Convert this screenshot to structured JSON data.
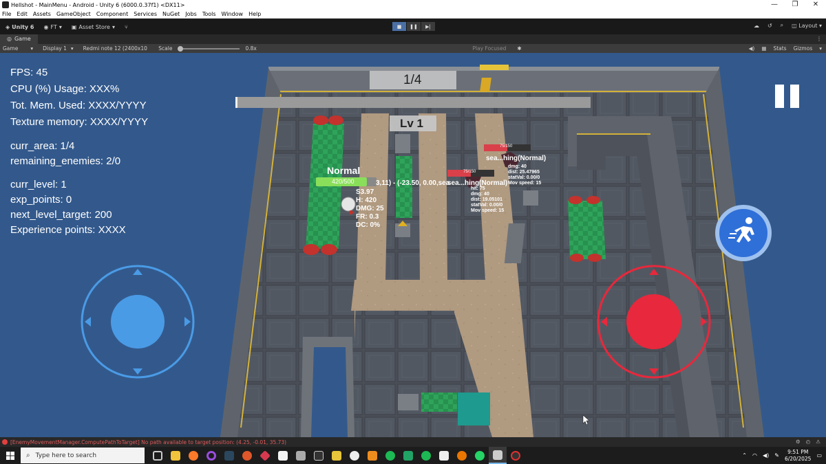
{
  "window": {
    "title": "Hellshot - MainMenu - Android - Unity 6 (6000.0.37f1) <DX11>",
    "minimize": "—",
    "restore": "❐",
    "close": "✕"
  },
  "menu": [
    "File",
    "Edit",
    "Assets",
    "GameObject",
    "Component",
    "Services",
    "NuGet",
    "Jobs",
    "Tools",
    "Window",
    "Help"
  ],
  "toolbar": {
    "unity_label": "Unity 6",
    "account": "FT",
    "asset_store": "Asset Store",
    "layout": "Layout"
  },
  "game_tab": {
    "label": "Game"
  },
  "game_bar": {
    "mode": "Game",
    "display": "Display 1",
    "device": "Redmi note 12 (2400x10 ",
    "scale_label": "Scale",
    "scale_value": "0.8x",
    "play_focused": "Play Focused",
    "stats": "Stats",
    "gizmos": "Gizmos"
  },
  "hud": {
    "fps": "FPS: 45",
    "cpu": "CPU (%) Usage: XXX%",
    "mem": "Tot. Mem. Used: XXXX/YYYY",
    "tex": "Texture memory: XXXX/YYYY",
    "area": "curr_area: 1/4",
    "enemies": "remaining_enemies: 2/0",
    "level": "curr_level: 1",
    "exp": "exp_points: 0",
    "next": "next_level_target: 200",
    "xp": "Experience points: XXXX"
  },
  "game": {
    "area_counter": "1/4",
    "level_badge": "Lv 1",
    "player_state": "Normal",
    "player_hp_text": "420/500",
    "player_hp": 0.84,
    "player_stats": [
      "S3.97",
      "H: 420",
      "DMG: 25",
      "FR: 0.3",
      "DC: 0%"
    ],
    "coords_text": "3,11) - (-23.50, 0.00,sea",
    "enemy1": {
      "hp_text": "75/150",
      "hp": 0.5,
      "state": "sea...hing(Normal)",
      "stats": [
        "hit: 75",
        "dmg: 40",
        "dist: 19.05101",
        "statVal: 0.00/0",
        "Mov speed: 15"
      ]
    },
    "enemy2": {
      "hp_text": "75/150",
      "hp": 0.5,
      "state": "sea...hing(Normal)",
      "stats": [
        "dmg: 40",
        "dist: 25.47965",
        "statVal: 0.00/0",
        "Mov speed: 15"
      ]
    }
  },
  "console_error": "[EnemyMovementManager.ComputePathToTarget] No path available to target position: (4.25, -0.01, 35.73)",
  "taskbar": {
    "search_placeholder": "Type here to search",
    "time": "9:51 PM",
    "date": "6/20/2025"
  },
  "colors": {
    "game_bg": "#33598c",
    "joystick_left": "#4a9be6",
    "joystick_right": "#e8283c",
    "dash_button": "#2f6fd8"
  }
}
